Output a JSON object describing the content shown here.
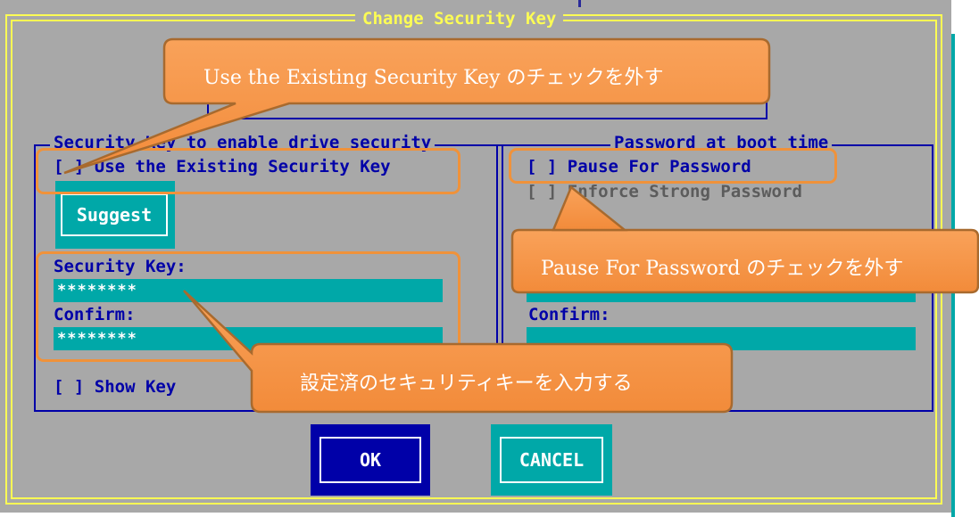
{
  "dialog": {
    "title": "Change Security Key",
    "colors": {
      "background": "#a8a8a8",
      "frame": "#fcfc54",
      "text": "#0000a8",
      "field": "#00a8a8",
      "callout": "#f79646"
    }
  },
  "left_group": {
    "label": "Security Key to enable drive security",
    "use_existing": {
      "checkbox": "[ ]",
      "label": "Use the Existing Security Key"
    },
    "suggest_label": "Suggest",
    "security_key_label": "Security Key:",
    "security_key_value": "********",
    "confirm_label": "Confirm:",
    "confirm_value": "********",
    "show_key": {
      "checkbox": "[ ]",
      "label": "Show Key"
    }
  },
  "right_group": {
    "label": "Password at boot time",
    "pause": {
      "checkbox": "[ ]",
      "label": "Pause For Password"
    },
    "enforce": {
      "checkbox": "[ ]",
      "label": "Enforce Strong Password"
    },
    "confirm_label": "Confirm:",
    "confirm_value": ""
  },
  "buttons": {
    "ok": "OK",
    "cancel": "CANCEL"
  },
  "callouts": {
    "existing_key": "Use the Existing Security Key のチェックを外す",
    "pause_password": "Pause For Password のチェックを外す",
    "enter_key": "設定済のセキュリティキーを入力する"
  }
}
